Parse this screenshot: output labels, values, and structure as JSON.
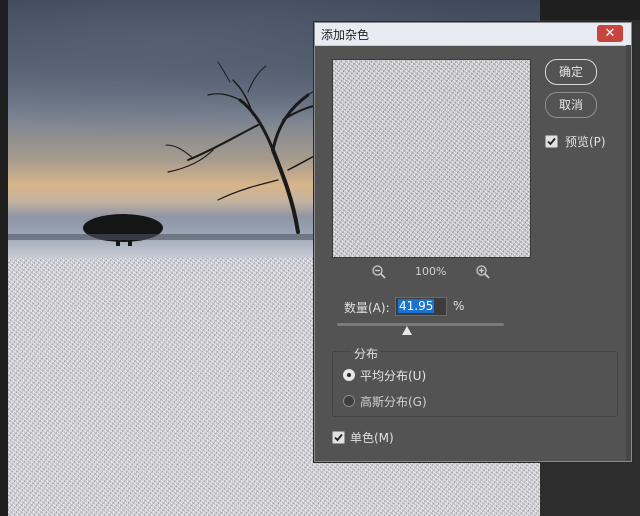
{
  "dialog": {
    "title": "添加杂色",
    "close_symbol": "✕",
    "ok_label": "确定",
    "cancel_label": "取消",
    "preview_label": "预览(P)",
    "preview_checked": true,
    "zoom_level": "100%",
    "amount_label": "数量(A):",
    "amount_value": "41.95",
    "amount_unit": "%",
    "amount_fraction": 0.42,
    "distribution": {
      "title": "分布",
      "options": [
        {
          "label": "平均分布(U)",
          "selected": true
        },
        {
          "label": "高斯分布(G)",
          "selected": false
        }
      ]
    },
    "monochrome_label": "单色(M)",
    "monochrome_checked": true
  },
  "icons": {
    "zoom_out": "zoom-out-icon",
    "zoom_in": "zoom-in-icon",
    "close": "close-icon",
    "check": "check-icon"
  },
  "colors": {
    "dialog_bg": "#535353",
    "title_bar": "#e8ecf2",
    "close_button": "#c7453c",
    "selection": "#1a73d1"
  }
}
